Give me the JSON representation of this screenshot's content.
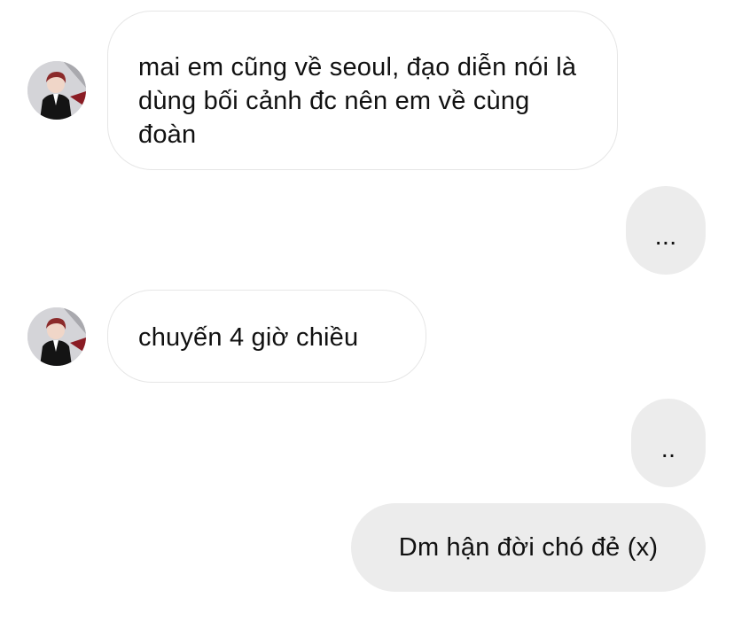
{
  "chat": {
    "messages": [
      {
        "from": "other",
        "text": "mai em cũng về seoul, đạo diễn nói là dùng bối cảnh đc nên em về cùng đoàn"
      },
      {
        "from": "me",
        "text": "..."
      },
      {
        "from": "other",
        "text": "chuyến 4 giờ chiều"
      },
      {
        "from": "me",
        "text": ".."
      },
      {
        "from": "me",
        "text": "Dm hận đời chó đẻ (x)"
      }
    ]
  },
  "colors": {
    "outgoing_bubble": "#ececec",
    "incoming_border": "#e6e6e6",
    "text": "#111111"
  }
}
